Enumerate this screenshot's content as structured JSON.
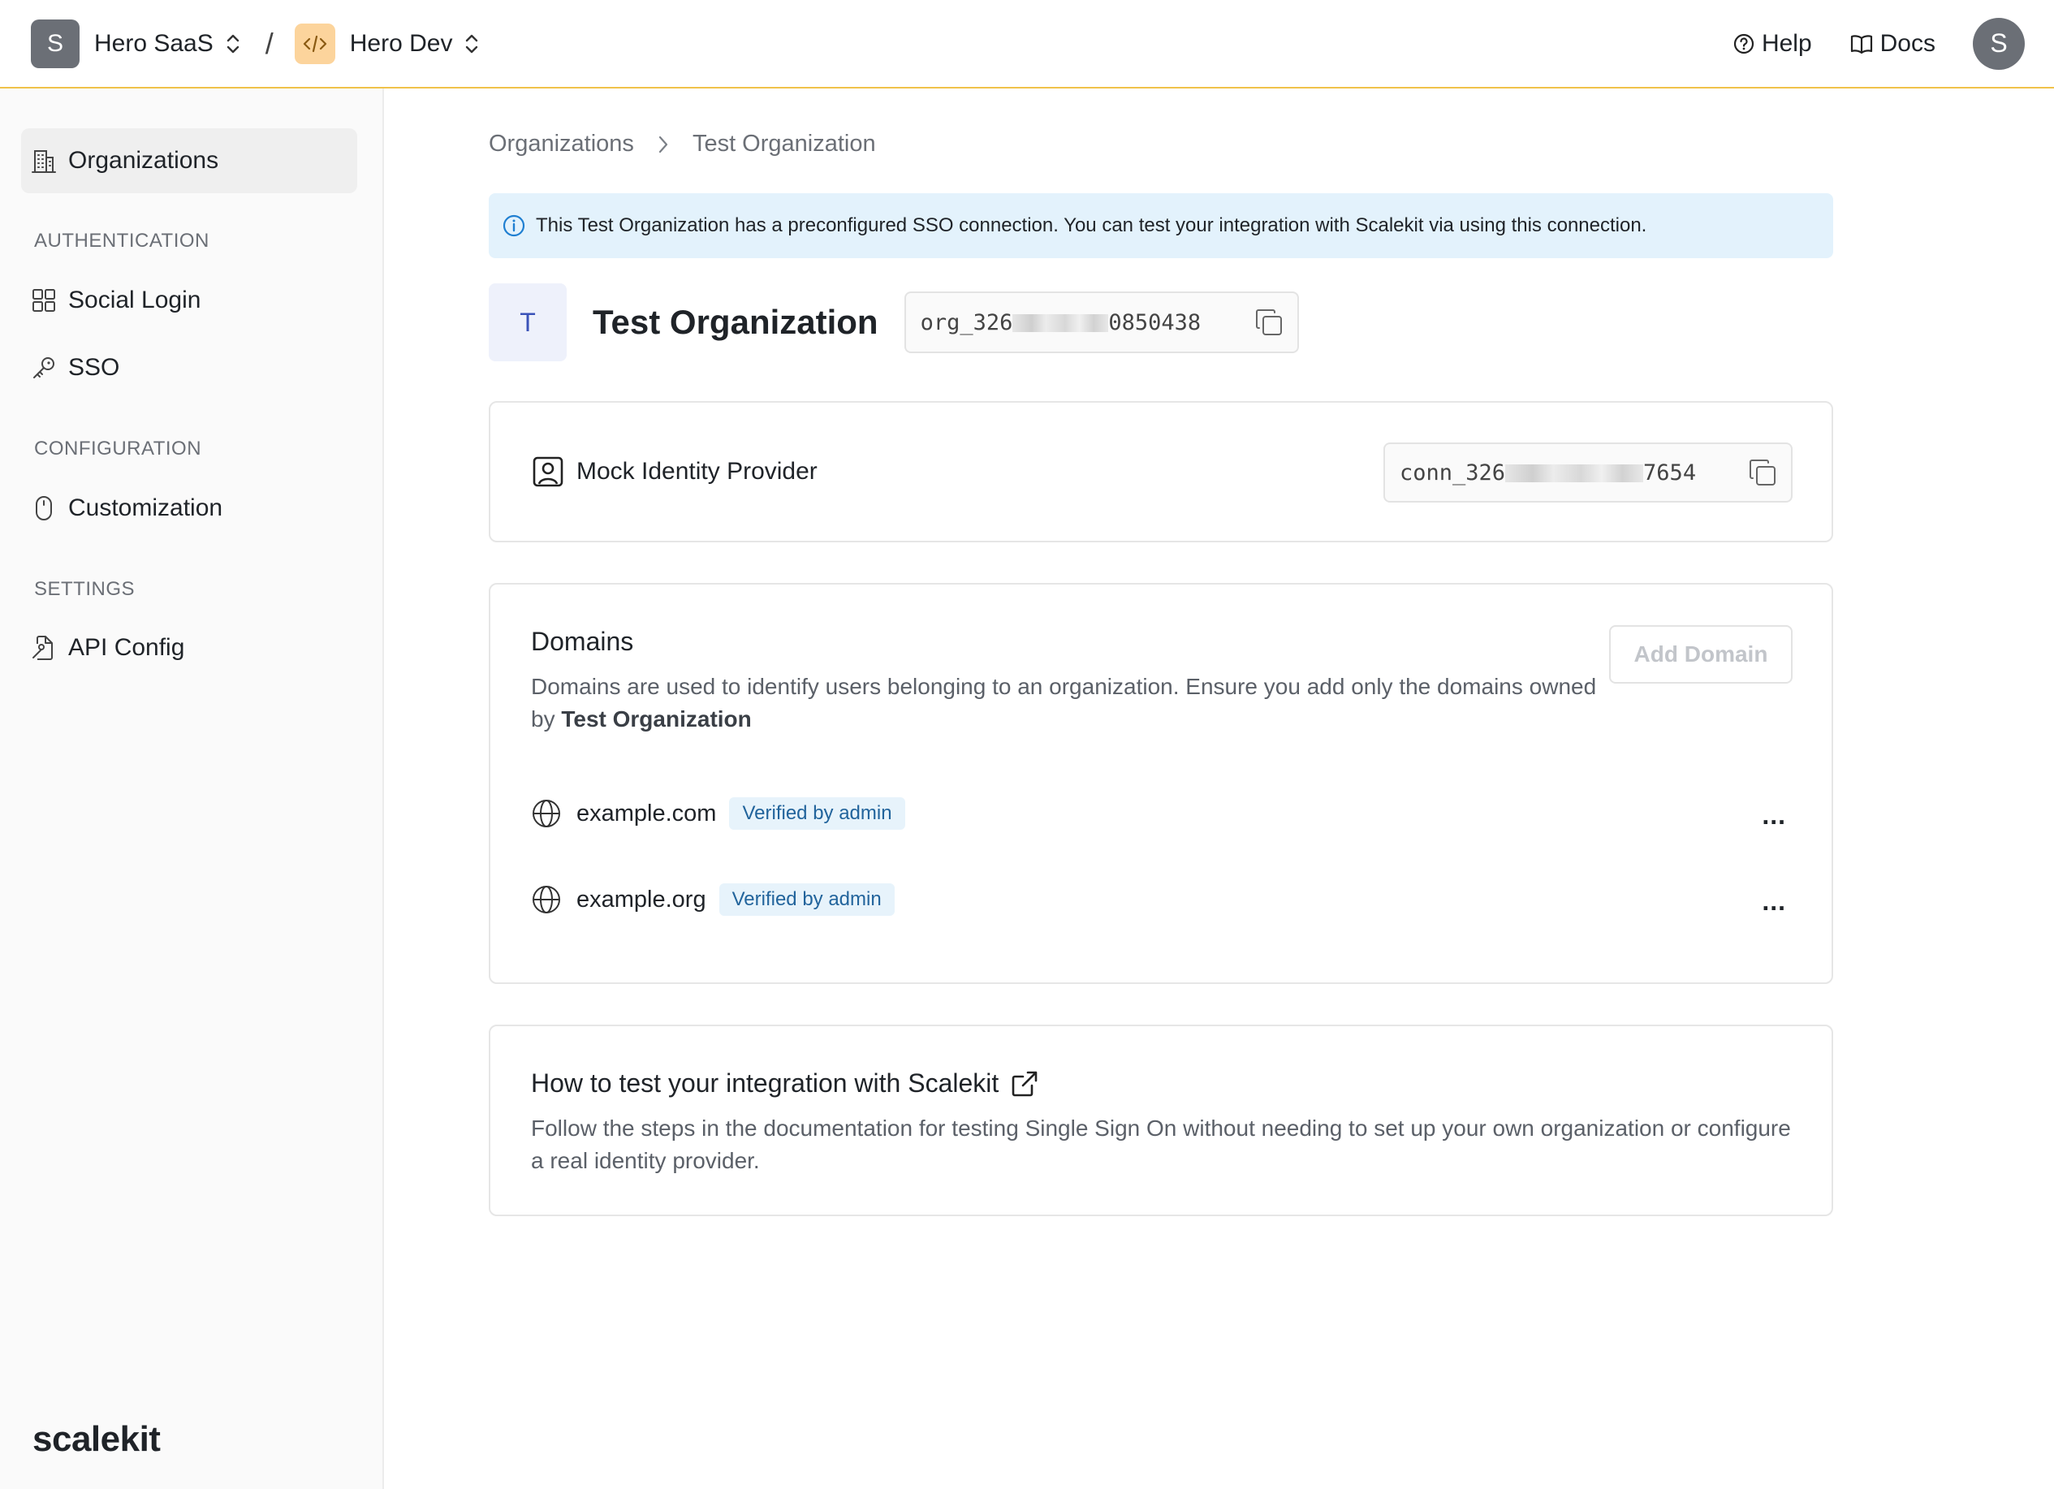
{
  "topbar": {
    "workspace_initial": "S",
    "workspace_name": "Hero SaaS",
    "separator": "/",
    "environment_name": "Hero Dev",
    "help_label": "Help",
    "docs_label": "Docs",
    "user_initial": "S",
    "accent_color": "#f0c24a"
  },
  "sidebar": {
    "organizations_label": "Organizations",
    "sections": {
      "authentication": "AUTHENTICATION",
      "configuration": "CONFIGURATION",
      "settings": "SETTINGS"
    },
    "social_login_label": "Social Login",
    "sso_label": "SSO",
    "customization_label": "Customization",
    "api_config_label": "API Config",
    "brand": "scalekit"
  },
  "breadcrumb": {
    "root": "Organizations",
    "current": "Test Organization"
  },
  "banner": {
    "text": "This Test Organization has a preconfigured SSO connection. You can test your integration with Scalekit via using this connection."
  },
  "org": {
    "initial": "T",
    "name": "Test Organization",
    "id_prefix": "org_326",
    "id_suffix": "0850438"
  },
  "idp": {
    "name": "Mock Identity Provider",
    "conn_prefix": "conn_326",
    "conn_suffix": "7654"
  },
  "domains": {
    "title": "Domains",
    "description": "Domains are used to identify users belonging to an organization. Ensure you add only the domains owned by ",
    "description_org": "Test Organization",
    "add_label": "Add Domain",
    "items": [
      {
        "name": "example.com",
        "badge": "Verified by admin"
      },
      {
        "name": "example.org",
        "badge": "Verified by admin"
      }
    ],
    "more_label": "..."
  },
  "howto": {
    "title": "How to test your integration with Scalekit",
    "description": "Follow the steps in the documentation for testing Single Sign On without needing to set up your own organization or configure a real identity provider."
  }
}
